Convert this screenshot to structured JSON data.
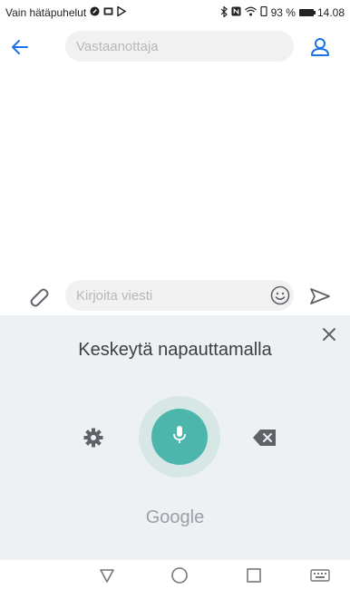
{
  "status_bar": {
    "carrier_text": "Vain hätäpuhelut",
    "battery_text": "93 %",
    "time": "14.08",
    "icons": [
      "maps-icon",
      "mail-icon",
      "play-store-icon",
      "bluetooth-icon",
      "nfc-icon",
      "wifi-icon",
      "vibrate-icon",
      "battery-icon"
    ]
  },
  "header": {
    "recipient_placeholder": "Vastaanottaja",
    "icons": [
      "back-arrow-icon",
      "contact-icon"
    ]
  },
  "composer": {
    "message_placeholder": "Kirjoita viesti",
    "icons": [
      "paperclip-icon",
      "emoji-icon",
      "send-icon"
    ]
  },
  "voice_input": {
    "title": "Keskeytä napauttamalla",
    "brand": "Google",
    "icons": [
      "close-icon",
      "gear-icon",
      "microphone-icon",
      "backspace-icon"
    ]
  },
  "colors": {
    "accent_blue": "#1a73e8",
    "mic_teal": "#4db6ac",
    "voice_panel_bg": "#edf1f4"
  },
  "nav_bar": {
    "icons": [
      "back-triangle-icon",
      "home-circle-icon",
      "recents-square-icon",
      "keyboard-icon"
    ]
  }
}
